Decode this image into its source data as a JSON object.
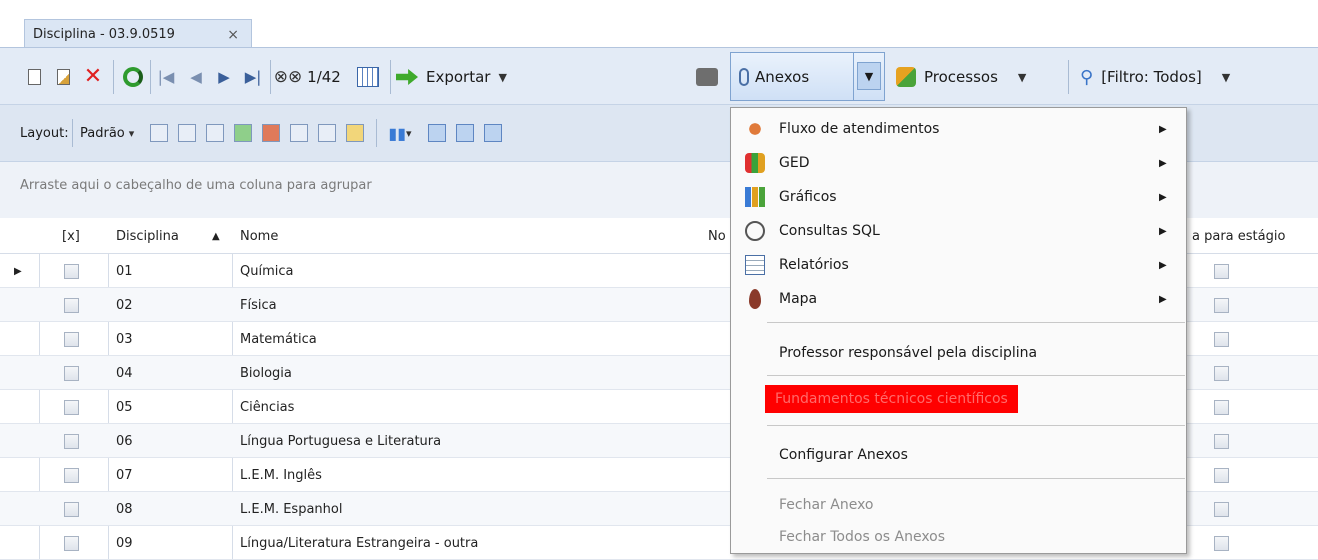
{
  "tab": {
    "title": "Disciplina - 03.9.0519",
    "close": "×"
  },
  "toolbar": {
    "record_position": "1/42",
    "export_label": "Exportar",
    "anexos_label": "Anexos",
    "processos_label": "Processos",
    "filter_label": "[Filtro: Todos]",
    "layout_label": "Layout:",
    "layout_value": "Padrão"
  },
  "group_panel": {
    "text": "Arraste aqui o cabeçalho de uma coluna para agrupar"
  },
  "grid": {
    "headers": {
      "check": "[x]",
      "disciplina": "Disciplina",
      "nome": "Nome",
      "no": "No",
      "estagio": "a para estágio"
    },
    "rows": [
      {
        "code": "01",
        "name": "Química"
      },
      {
        "code": "02",
        "name": "Física"
      },
      {
        "code": "03",
        "name": "Matemática"
      },
      {
        "code": "04",
        "name": "Biologia"
      },
      {
        "code": "05",
        "name": "Ciências"
      },
      {
        "code": "06",
        "name": "Língua Portuguesa e Literatura"
      },
      {
        "code": "07",
        "name": "L.E.M. Inglês"
      },
      {
        "code": "08",
        "name": "L.E.M. Espanhol"
      },
      {
        "code": "09",
        "name": "Língua/Literatura Estrangeira - outra"
      }
    ]
  },
  "menu": {
    "items": [
      {
        "label": "Fluxo de atendimentos",
        "icon": "flow-icon"
      },
      {
        "label": "GED",
        "icon": "ged-icon"
      },
      {
        "label": "Gráficos",
        "icon": "chart-icon"
      },
      {
        "label": "Consultas SQL",
        "icon": "sql-query-icon"
      },
      {
        "label": "Relatórios",
        "icon": "report-icon"
      },
      {
        "label": "Mapa",
        "icon": "map-pin-icon"
      }
    ],
    "professor": "Professor responsável pela disciplina",
    "fundamentos": "Fundamentos técnicos científicos",
    "configurar": "Configurar Anexos",
    "fechar": "Fechar Anexo",
    "fechar_todos": "Fechar Todos os Anexos"
  },
  "colors": {
    "highlight": "#ff0000",
    "toolbar_bg": "#e3ebf6"
  }
}
